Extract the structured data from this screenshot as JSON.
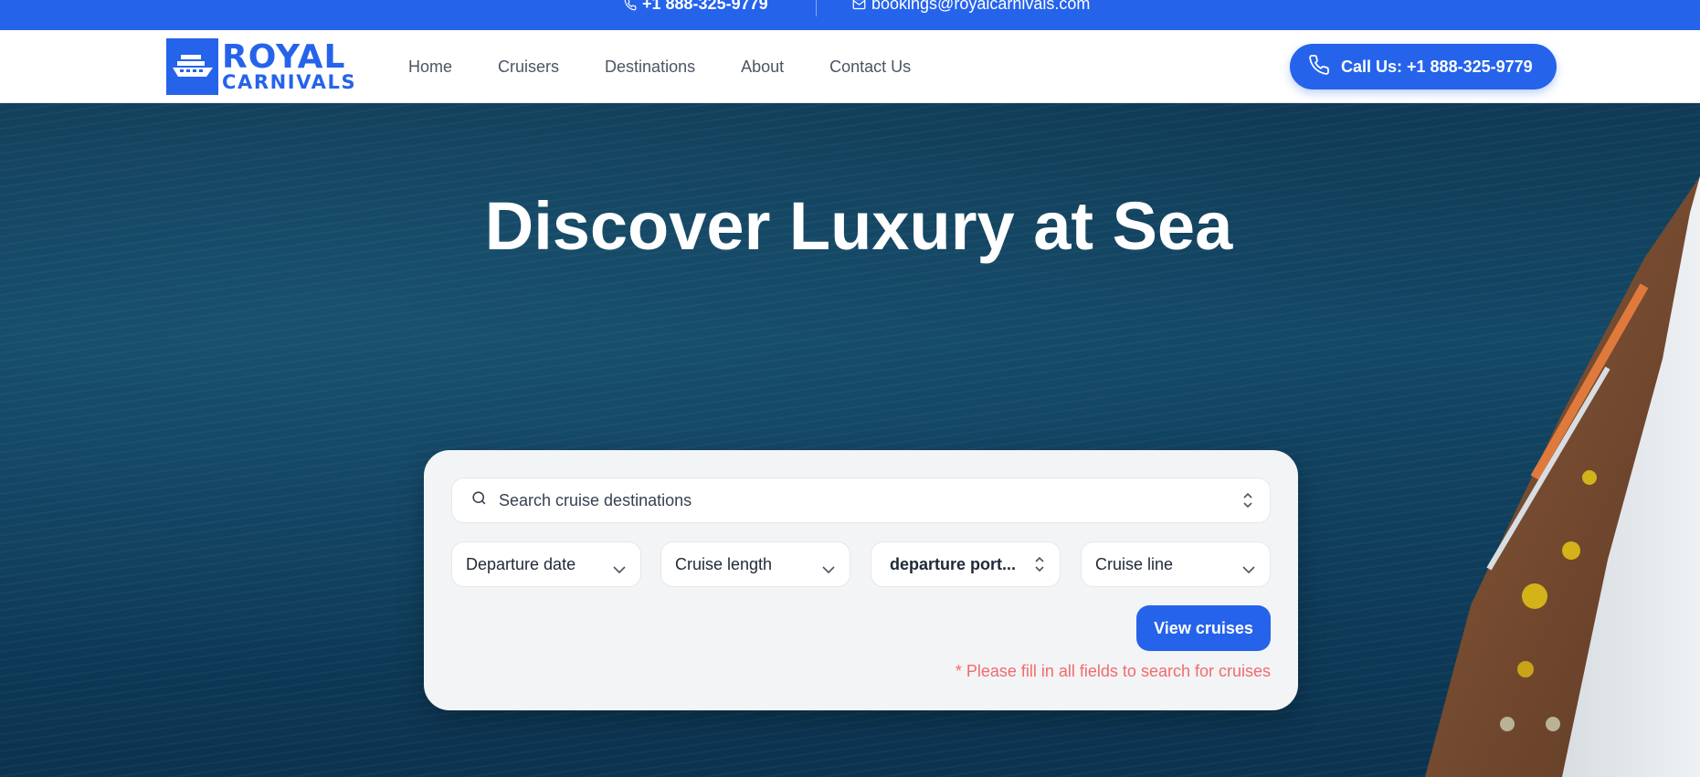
{
  "topbar": {
    "phone": "+1 888-325-9779",
    "email": "bookings@royalcarnivals.com"
  },
  "brand": {
    "line1": "ROYAL",
    "line2": "CARNIVALS",
    "accent_color": "#2563eb"
  },
  "nav": {
    "links": [
      "Home",
      "Cruisers",
      "Destinations",
      "About",
      "Contact Us"
    ],
    "call_button": "Call Us: +1 888-325-9779"
  },
  "hero": {
    "title": "Discover Luxury at Sea"
  },
  "search": {
    "placeholder": "Search cruise destinations",
    "filters": {
      "departure_date": "Departure date",
      "cruise_length": "Cruise length",
      "departure_port": "departure port...",
      "cruise_line": "Cruise line"
    },
    "submit": "View cruises",
    "warning": "* Please fill in all fields to search for cruises",
    "warning_color": "#f26b6b"
  },
  "icons": [
    "phone-icon",
    "mail-icon",
    "ship-icon",
    "search-icon",
    "chevron-updown-icon",
    "chevron-down-icon"
  ]
}
